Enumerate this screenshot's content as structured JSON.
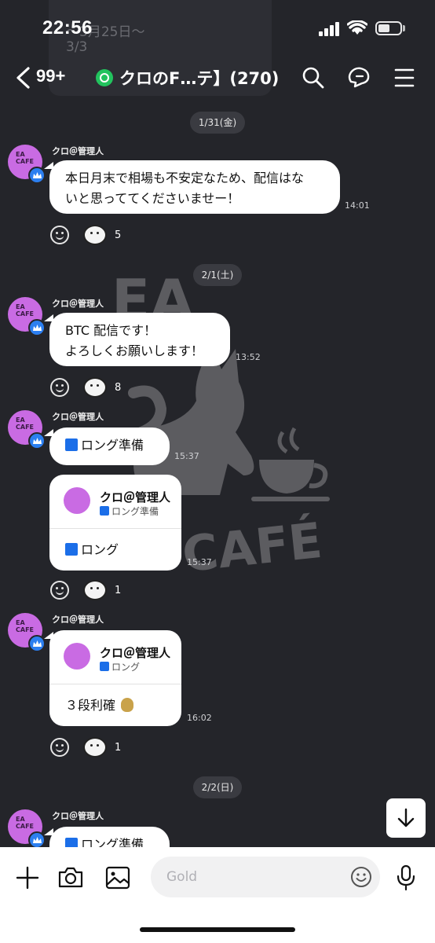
{
  "status": {
    "time": "22:56"
  },
  "ghost": {
    "line1": "〜3月25日〜",
    "line2": "3/3"
  },
  "header": {
    "unread_count": "99+",
    "title": "クロのF…テ】(270)"
  },
  "chat": {
    "dates": [
      "1/31(金)",
      "2/1(土)",
      "2/2(日)"
    ],
    "messages": [
      {
        "sender": "クロ＠管理人",
        "text1": "本日月末で相場も不安定なため、配信はな",
        "text2": "いと思っててくださいませー！",
        "time": "14:01",
        "reactions": "5"
      },
      {
        "sender": "クロ＠管理人",
        "text1": "BTC 配信です！",
        "text2": "よろしくお願いします！",
        "time": "13:52",
        "reactions": "8"
      },
      {
        "sender": "クロ＠管理人",
        "text": "ロング準備",
        "time": "15:37"
      },
      {
        "quote_name": "クロ＠管理人",
        "quote_sub": "ロング準備",
        "text": "ロング",
        "time": "15:37",
        "reactions": "1"
      },
      {
        "sender": "クロ＠管理人",
        "quote_name": "クロ＠管理人",
        "quote_sub": "ロング",
        "text": "３段利確",
        "time": "16:02",
        "reactions": "1"
      },
      {
        "sender": "クロ＠管理人",
        "text": "ロング準備"
      }
    ],
    "avatar_label": "EA CAFE",
    "watermark": {
      "top": "EA",
      "bottom": "CAFÉ"
    }
  },
  "composer": {
    "placeholder": "Gold"
  },
  "colors": {
    "background": "#24252a",
    "bubble": "#ffffff",
    "accent_blue": "#1b6ee8",
    "avatar": "#c96be3",
    "status_green": "#22c35e"
  }
}
